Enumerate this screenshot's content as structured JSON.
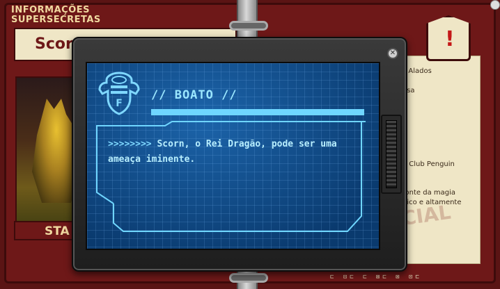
{
  "dossier": {
    "header_title": "INFORMAÇÕES SUPERSECRETAS",
    "name_partial": "Scor",
    "status_partial": "STA",
    "paper_lines": [
      "s Alados",
      "osa",
      "o Club Penguin",
      "fonte da magia",
      "nico e altamente"
    ],
    "stamp_text": "CIAL",
    "alert_icon": "!",
    "footer_icons": "⊏ ⊡⊏  ⊏ ⊠⊏ ⊠ ⊡⊏"
  },
  "dialog": {
    "heading": "// BOATO //",
    "message_prefix": ">>>>>>>> ",
    "message": "Scorn, o Rei Dragão, pode ser uma ameaça iminente.",
    "close_glyph": "✕",
    "emblem_letter": "F"
  },
  "colors": {
    "screen_blue": "#0e4a86",
    "accent_cyan": "#6fd6ff",
    "dossier_red": "#6e1818",
    "paper": "#efe6c6"
  }
}
